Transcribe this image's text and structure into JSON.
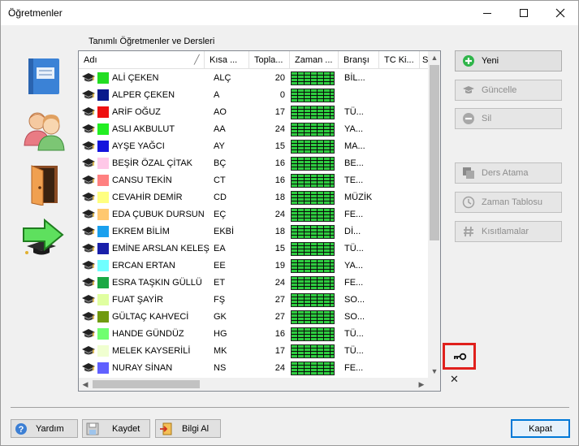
{
  "window": {
    "title": "Öğretmenler"
  },
  "group": {
    "label": "Tanımlı Öğretmenler ve Dersleri"
  },
  "columns": [
    "Adı",
    "Kısa ...",
    "Topla...",
    "Zaman ...",
    "Branşı",
    "TC Ki...",
    "S"
  ],
  "rows": [
    {
      "name": "ALİ ÇEKEN",
      "abbr": "ALÇ",
      "total": "20",
      "branch": "BİL...",
      "color": "#22dd22"
    },
    {
      "name": "ALPER ÇEKEN",
      "abbr": "A",
      "total": "0",
      "branch": "",
      "color": "#0a1a8c"
    },
    {
      "name": "ARİF OĞUZ",
      "abbr": "AO",
      "total": "17",
      "branch": "TÜ...",
      "color": "#ee1111"
    },
    {
      "name": "ASLI AKBULUT",
      "abbr": "AA",
      "total": "24",
      "branch": "YA...",
      "color": "#22ee22"
    },
    {
      "name": "AYŞE YAĞCI",
      "abbr": "AY",
      "total": "15",
      "branch": "MA...",
      "color": "#1414dd"
    },
    {
      "name": "BEŞİR ÖZAL ÇİTAK",
      "abbr": "BÇ",
      "total": "16",
      "branch": "BE...",
      "color": "#ffc8e8"
    },
    {
      "name": "CANSU TEKİN",
      "abbr": "CT",
      "total": "16",
      "branch": "TE...",
      "color": "#ff8080"
    },
    {
      "name": "CEVAHİR DEMİR",
      "abbr": "CD",
      "total": "18",
      "branch": "MÜZİK",
      "color": "#ffff80"
    },
    {
      "name": "EDA ÇUBUK DURSUN",
      "abbr": "EÇ",
      "total": "24",
      "branch": "FE...",
      "color": "#ffc870"
    },
    {
      "name": "EKREM BİLİM",
      "abbr": "EKBİ",
      "total": "18",
      "branch": "Dİ...",
      "color": "#1aa0ee"
    },
    {
      "name": "EMİNE ARSLAN KELEŞ",
      "abbr": "EA",
      "total": "15",
      "branch": "TÜ...",
      "color": "#1a20aa"
    },
    {
      "name": "ERCAN ERTAN",
      "abbr": "EE",
      "total": "19",
      "branch": "YA...",
      "color": "#70ffff"
    },
    {
      "name": "ESRA TAŞKIN GÜLLÜ",
      "abbr": "ET",
      "total": "24",
      "branch": "FE...",
      "color": "#1aa844"
    },
    {
      "name": "FUAT ŞAYİR",
      "abbr": "FŞ",
      "total": "27",
      "branch": "SO...",
      "color": "#e0ffa0"
    },
    {
      "name": "GÜLTAÇ KAHVECİ",
      "abbr": "GK",
      "total": "27",
      "branch": "SO...",
      "color": "#709a10"
    },
    {
      "name": "HANDE GÜNDÜZ",
      "abbr": "HG",
      "total": "16",
      "branch": "TÜ...",
      "color": "#70ff70"
    },
    {
      "name": "MELEK KAYSERİLİ",
      "abbr": "MK",
      "total": "17",
      "branch": "TÜ...",
      "color": "#f0ffd0"
    },
    {
      "name": "NURAY SİNAN",
      "abbr": "NS",
      "total": "24",
      "branch": "FE...",
      "color": "#6060ff"
    }
  ],
  "actions": {
    "new": "Yeni",
    "update": "Güncelle",
    "delete": "Sil",
    "assign": "Ders Atama",
    "schedule": "Zaman Tablosu",
    "constraints": "Kısıtlamalar"
  },
  "footer": {
    "help": "Yardım",
    "save": "Kaydet",
    "import": "Bilgi Al",
    "close": "Kapat"
  },
  "icons": {
    "teacher-row": "graduation-cap-icon",
    "side": [
      "book-icon",
      "teachers-icon",
      "door-icon",
      "arrow-exit-icon"
    ]
  },
  "accent": "#0078d7",
  "highlight": "#e0201c"
}
